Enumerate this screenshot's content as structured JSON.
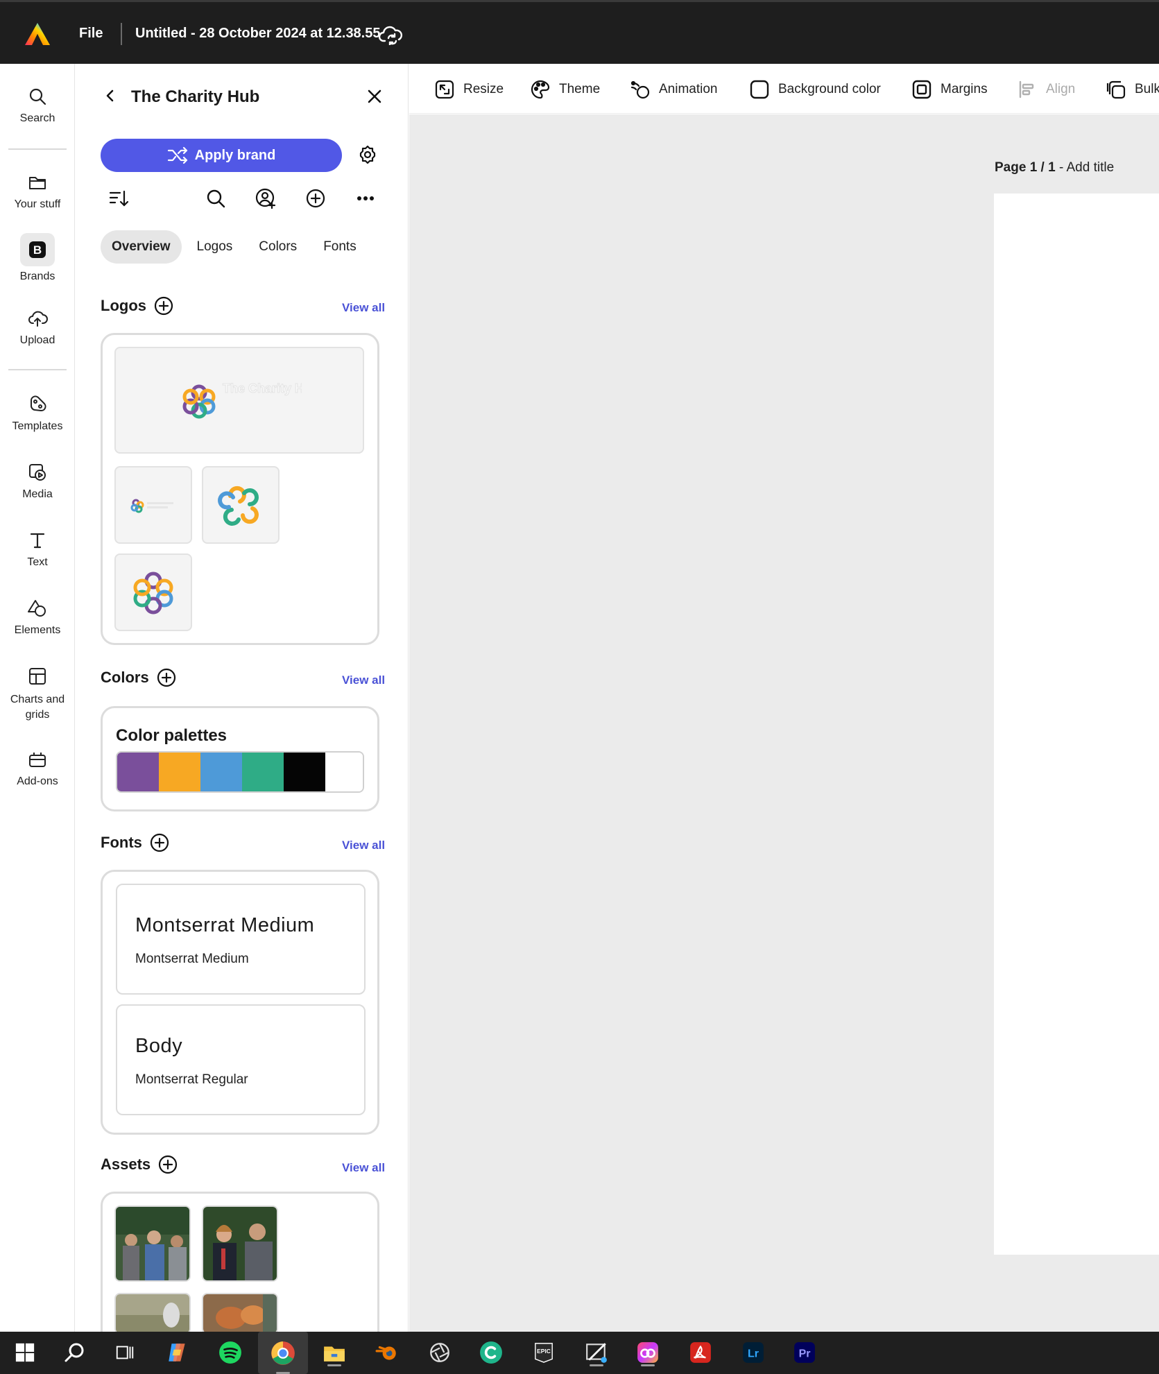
{
  "topbar": {
    "file_label": "File",
    "doc_title": "Untitled - 28 October 2024 at 12.38.55"
  },
  "rail": {
    "items": [
      {
        "label": "Search",
        "icon": "search-icon"
      },
      {
        "label": "Your stuff",
        "icon": "folder-icon"
      },
      {
        "label": "Brands",
        "icon": "brand-b-icon"
      },
      {
        "label": "Upload",
        "icon": "cloud-upload-icon"
      },
      {
        "label": "Templates",
        "icon": "templates-icon"
      },
      {
        "label": "Media",
        "icon": "media-icon"
      },
      {
        "label": "Text",
        "icon": "text-t-icon"
      },
      {
        "label": "Elements",
        "icon": "elements-icon"
      },
      {
        "label": "Charts and grids",
        "icon": "grid-icon"
      },
      {
        "label": "Add-ons",
        "icon": "addons-icon"
      }
    ]
  },
  "panel": {
    "title": "The Charity Hub",
    "apply_label": "Apply brand",
    "tabs": [
      "Overview",
      "Logos",
      "Colors",
      "Fonts"
    ],
    "logos": {
      "heading": "Logos",
      "view_all": "View all",
      "logo_wordmark": "The Charity Hub"
    },
    "colors": {
      "heading": "Colors",
      "view_all": "View all",
      "palette_title": "Color palettes",
      "swatches": [
        "#7a4f9b",
        "#f7a823",
        "#4e9ad8",
        "#2fac86",
        "#050505",
        "#ffffff"
      ]
    },
    "fonts": {
      "heading": "Fonts",
      "view_all": "View all",
      "items": [
        {
          "name": "Montserrat Medium",
          "family": "Montserrat Medium"
        },
        {
          "name": "Body",
          "family": "Montserrat Regular"
        }
      ]
    },
    "assets": {
      "heading": "Assets",
      "view_all": "View all"
    }
  },
  "toolbar": {
    "items": [
      {
        "label": "Resize",
        "icon": "resize-icon"
      },
      {
        "label": "Theme",
        "icon": "palette-icon"
      },
      {
        "label": "Animation",
        "icon": "animation-icon"
      },
      {
        "label": "Background color",
        "icon": "background-color-icon"
      },
      {
        "label": "Margins",
        "icon": "margins-icon"
      },
      {
        "label": "Align",
        "icon": "align-icon"
      },
      {
        "label": "Bulk",
        "icon": "bulk-icon"
      }
    ]
  },
  "canvas": {
    "page_number": "Page 1 / 1",
    "page_title_placeholder": "- Add title"
  },
  "taskbar": {
    "apps": [
      "start-icon",
      "search-icon",
      "task-view-icon",
      "copilot-icon",
      "spotify-icon",
      "chrome-icon",
      "file-explorer-icon",
      "blender-icon",
      "aperture-icon",
      "canva-icon",
      "epic-games-icon",
      "sketch-icon",
      "creative-cloud-icon",
      "acrobat-icon",
      "lightroom-icon",
      "premiere-icon"
    ],
    "epic_label": "EPIC",
    "lr_label": "Lr",
    "pr_label": "Pr"
  },
  "colors": {
    "accent": "#5158e6",
    "link": "#4a52d6",
    "topbar": "#1e1e1e",
    "canvas": "#ebebeb"
  }
}
